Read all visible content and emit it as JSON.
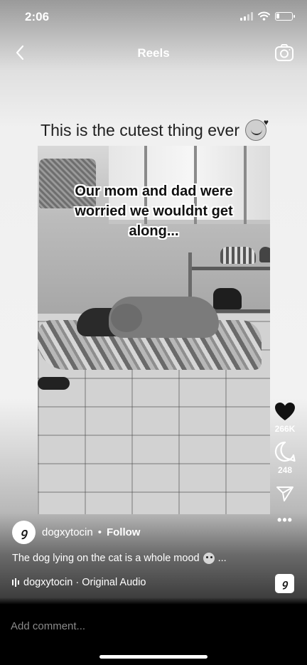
{
  "status_bar": {
    "time": "2:06",
    "battery_level": 0.2
  },
  "header": {
    "title": "Reels",
    "back_icon": "chevron-left-icon",
    "camera_icon": "camera-icon"
  },
  "post": {
    "caption_top": "This is the cutest thing ever",
    "video_overlay_text": "Our mom and dad were worried we wouldnt get along...",
    "author": {
      "username": "dogxytocin",
      "follow_label": "Follow"
    },
    "caption": "The dog lying on the cat is a whole mood",
    "caption_more": "...",
    "audio_label": "dogxytocin · Original Audio"
  },
  "actions": {
    "likes": "266K",
    "comments": "248"
  },
  "comment_bar": {
    "placeholder": "Add comment..."
  },
  "colors": {
    "comment_bar_bg": "#000000",
    "text_light": "#ffffff",
    "caption_dark": "#222222"
  }
}
